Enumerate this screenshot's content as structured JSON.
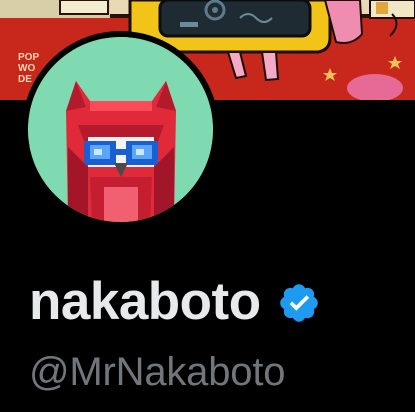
{
  "profile": {
    "display_name": "nakaboto",
    "handle": "@MrNakaboto",
    "verified": true,
    "verified_icon": "verified-badge-icon"
  },
  "banner": {
    "art_text_lines": [
      "POP",
      "WO",
      "DE"
    ]
  },
  "colors": {
    "background": "#000000",
    "banner_red": "#c8281c",
    "avatar_bg": "#7fd9b1",
    "name_text": "#e7e9ea",
    "handle_text": "#71767b",
    "verified_blue": "#1d9bf0"
  }
}
